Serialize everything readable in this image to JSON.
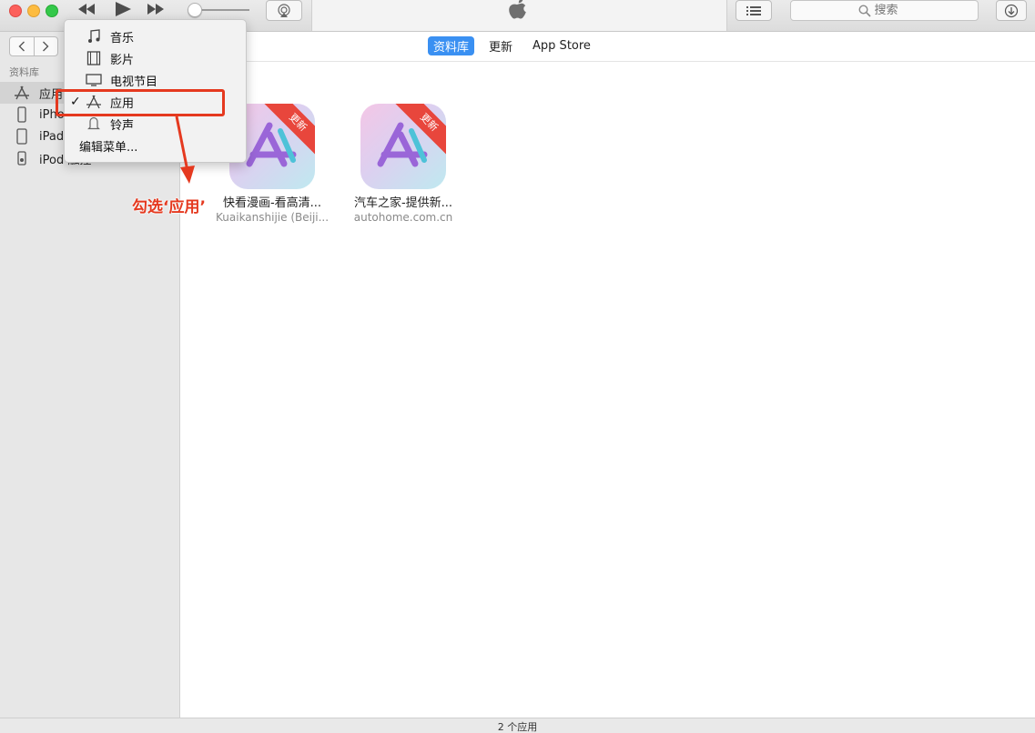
{
  "toolbar": {
    "search_placeholder": "搜索"
  },
  "sidebar": {
    "heading": "资料库",
    "items": [
      {
        "label": "应用",
        "icon": "app-store-icon",
        "selected": true
      },
      {
        "label": "iPhone",
        "icon": "iphone-icon"
      },
      {
        "label": "iPad",
        "icon": "ipad-icon"
      },
      {
        "label": "iPod 触控",
        "icon": "ipod-icon"
      }
    ]
  },
  "tabs": [
    {
      "label": "资料库",
      "active": true
    },
    {
      "label": "更新"
    },
    {
      "label": "App Store"
    }
  ],
  "apps": [
    {
      "name": "快看漫画-看高清...",
      "developer": "Kuaikanshijie (Beiji...",
      "badge": "更新"
    },
    {
      "name": "汽车之家-提供新...",
      "developer": "autohome.com.cn",
      "badge": "更新"
    }
  ],
  "menu": {
    "items": [
      {
        "label": "音乐",
        "icon": "music-note-icon"
      },
      {
        "label": "影片",
        "icon": "film-icon"
      },
      {
        "label": "电视节目",
        "icon": "tv-icon"
      },
      {
        "label": "应用",
        "icon": "app-store-icon",
        "checked": true,
        "check_mark": "✓"
      },
      {
        "label": "铃声",
        "icon": "bell-icon"
      },
      {
        "label": "编辑菜单..."
      }
    ]
  },
  "annotation": {
    "text": "勾选‘应用’",
    "color": "#e5391f"
  },
  "status": {
    "text": "2 个应用"
  },
  "colors": {
    "accent": "#3a90f2",
    "badge": "#e8463c"
  }
}
